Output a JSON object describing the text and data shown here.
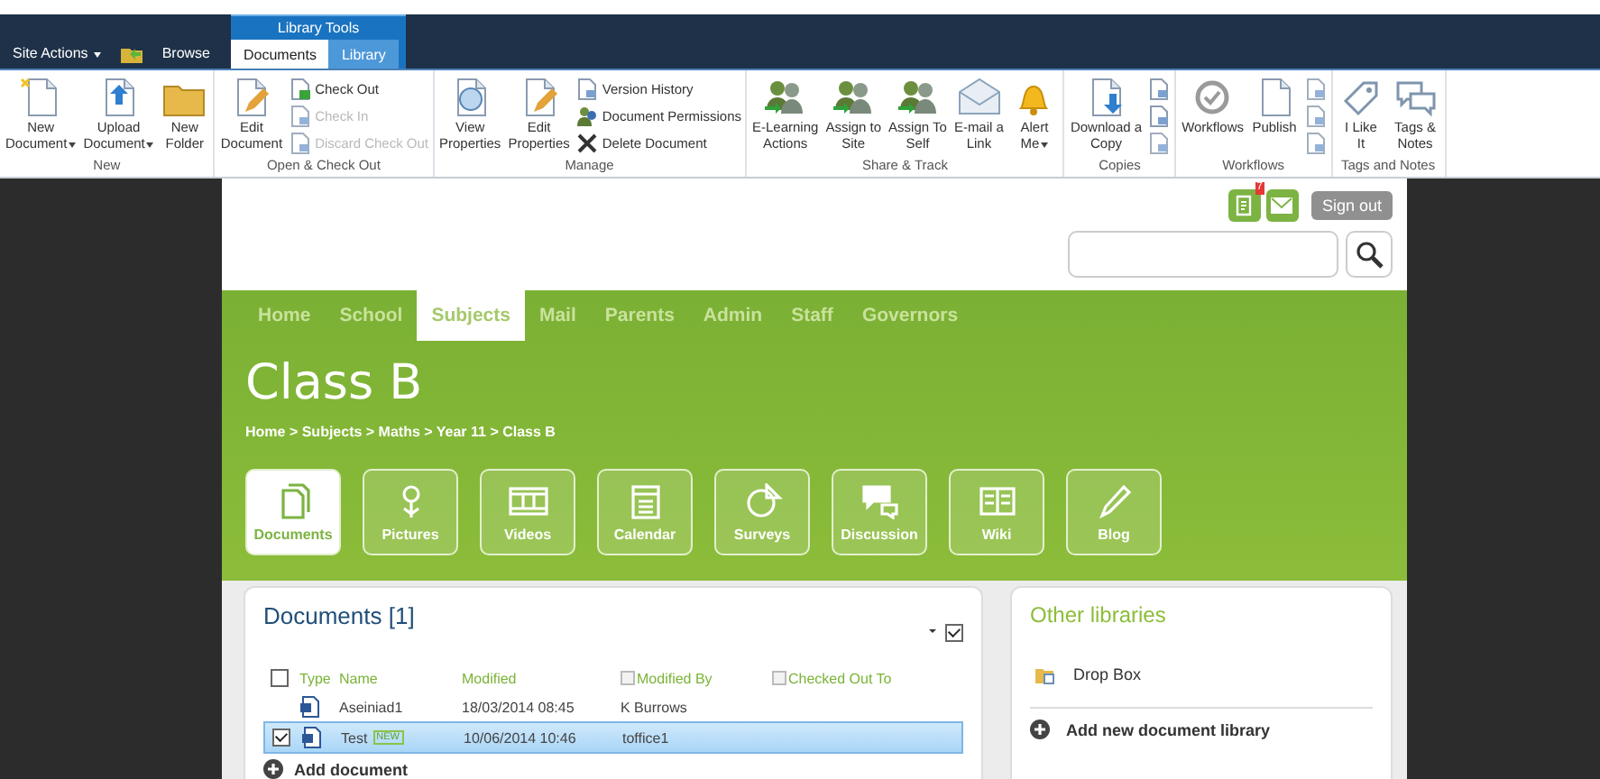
{
  "top_bar": {
    "site_actions": "Site Actions",
    "browse": "Browse",
    "context_label": "Library Tools",
    "tabs": [
      {
        "label": "Documents",
        "selected": true
      },
      {
        "label": "Library",
        "selected": false
      }
    ]
  },
  "ribbon": {
    "groups": [
      {
        "label": "New",
        "items": [
          {
            "kind": "large",
            "lines": [
              "New",
              "Document"
            ],
            "menu": true,
            "disabled": false
          },
          {
            "kind": "large",
            "lines": [
              "Upload",
              "Document"
            ],
            "menu": true,
            "disabled": false
          },
          {
            "kind": "large",
            "lines": [
              "New",
              "Folder"
            ],
            "menu": false,
            "disabled": false
          }
        ]
      },
      {
        "label": "Open & Check Out",
        "items": [
          {
            "kind": "large",
            "lines": [
              "Edit",
              "Document"
            ],
            "menu": false,
            "disabled": false
          },
          {
            "kind": "stack",
            "items": [
              {
                "label": "Check Out",
                "disabled": false
              },
              {
                "label": "Check In",
                "disabled": true
              },
              {
                "label": "Discard Check Out",
                "disabled": true
              }
            ]
          }
        ]
      },
      {
        "label": "Manage",
        "items": [
          {
            "kind": "large",
            "lines": [
              "View",
              "Properties"
            ],
            "menu": false,
            "disabled": false
          },
          {
            "kind": "large",
            "lines": [
              "Edit",
              "Properties"
            ],
            "menu": false,
            "disabled": false
          },
          {
            "kind": "stack",
            "items": [
              {
                "label": "Version History",
                "disabled": false
              },
              {
                "label": "Document Permissions",
                "disabled": false
              },
              {
                "label": "Delete Document",
                "disabled": false
              }
            ]
          }
        ]
      },
      {
        "label": "Share & Track",
        "items": [
          {
            "kind": "large",
            "lines": [
              "E-Learning",
              "Actions"
            ],
            "menu": false,
            "disabled": false
          },
          {
            "kind": "large",
            "lines": [
              "Assign to",
              "Site"
            ],
            "menu": false,
            "disabled": false
          },
          {
            "kind": "large",
            "lines": [
              "Assign To",
              "Self"
            ],
            "menu": false,
            "disabled": false
          },
          {
            "kind": "large",
            "lines": [
              "E-mail a",
              "Link"
            ],
            "menu": false,
            "disabled": false
          },
          {
            "kind": "large",
            "lines": [
              "Alert",
              "Me"
            ],
            "menu": true,
            "disabled": false
          }
        ]
      },
      {
        "label": "Copies",
        "items": [
          {
            "kind": "large",
            "lines": [
              "Download a",
              "Copy"
            ],
            "menu": false,
            "disabled": false
          },
          {
            "kind": "stack",
            "items": [
              {
                "disabled": false
              },
              {
                "disabled": false
              },
              {
                "disabled": true
              }
            ]
          }
        ]
      },
      {
        "label": "Workflows",
        "items": [
          {
            "kind": "large",
            "lines": [
              "Workflows"
            ],
            "menu": false,
            "disabled": false
          },
          {
            "kind": "large",
            "lines": [
              "Publish"
            ],
            "menu": false,
            "disabled": false
          },
          {
            "kind": "stack",
            "items": [
              {
                "disabled": true
              },
              {
                "disabled": true
              },
              {
                "disabled": true
              }
            ]
          }
        ]
      },
      {
        "label": "Tags and Notes",
        "items": [
          {
            "kind": "large",
            "lines": [
              "I Like",
              "It"
            ],
            "menu": false,
            "disabled": false
          },
          {
            "kind": "large",
            "lines": [
              "Tags &",
              "Notes"
            ],
            "menu": false,
            "disabled": false
          }
        ]
      }
    ]
  },
  "header": {
    "notification_count": "7",
    "sign_out": "Sign out"
  },
  "nav": [
    {
      "label": "Home",
      "selected": false
    },
    {
      "label": "School",
      "selected": false
    },
    {
      "label": "Subjects",
      "selected": true
    },
    {
      "label": "Mail",
      "selected": false
    },
    {
      "label": "Parents",
      "selected": false
    },
    {
      "label": "Admin",
      "selected": false
    },
    {
      "label": "Staff",
      "selected": false
    },
    {
      "label": "Governors",
      "selected": false
    }
  ],
  "title": "Class B",
  "breadcrumb": "Home > Subjects > Maths > Year 11 > Class B",
  "tiles": [
    {
      "label": "Documents",
      "selected": true
    },
    {
      "label": "Pictures",
      "selected": false
    },
    {
      "label": "Videos",
      "selected": false
    },
    {
      "label": "Calendar",
      "selected": false
    },
    {
      "label": "Surveys",
      "selected": false
    },
    {
      "label": "Discussion",
      "selected": false
    },
    {
      "label": "Wiki",
      "selected": false
    },
    {
      "label": "Blog",
      "selected": false
    }
  ],
  "documents": {
    "title": "Documents [1]",
    "view_toggle": {
      "checked": true
    },
    "select_all": {
      "checked": false
    },
    "columns": [
      {
        "label": "Type",
        "filterable": false
      },
      {
        "label": "Name",
        "filterable": false
      },
      {
        "label": "Modified",
        "filterable": false
      },
      {
        "label": "Modified By",
        "filterable": true
      },
      {
        "label": "Checked Out To",
        "filterable": true
      }
    ],
    "rows": [
      {
        "name": "Aseiniad1",
        "modified": "18/03/2014 08:45",
        "modified_by": "K Burrows",
        "selected": false
      },
      {
        "name": "Test",
        "badge": "NEW",
        "modified": "10/06/2014 10:46",
        "modified_by": "toffice1",
        "selected": true
      }
    ],
    "add_link": "Add document"
  },
  "other_libraries": {
    "title": "Other libraries",
    "items": [
      "Drop Box"
    ],
    "add_link": "Add new document library"
  }
}
